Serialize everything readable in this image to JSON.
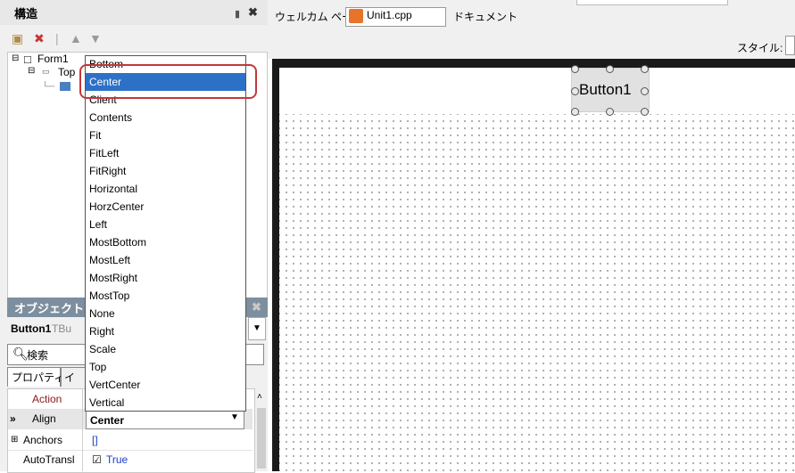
{
  "structure": {
    "title": "構造",
    "tree": {
      "root": "Form1",
      "child": "Top"
    }
  },
  "tabs": {
    "welcome": "ウェルカム ページ",
    "unit1": "Unit1.cpp",
    "docs": "ドキュメント"
  },
  "toolbar": {
    "style_label": "スタイル:"
  },
  "designer": {
    "button_caption": "Button1"
  },
  "inspector": {
    "title": "オブジェクト",
    "object_name": "Button1",
    "object_type": "TBu",
    "search_placeholder": "検索",
    "tab_properties": "プロパティ",
    "tab_events": "イ"
  },
  "properties": [
    {
      "name": "Action",
      "value": ""
    },
    {
      "name": "Align",
      "value": "Center"
    },
    {
      "name": "Anchors",
      "value": "[]"
    },
    {
      "name": "AutoTransl",
      "value": "True"
    }
  ],
  "dropdown": {
    "selected": "Center",
    "options": [
      "Bottom",
      "Center",
      "Client",
      "Contents",
      "Fit",
      "FitLeft",
      "FitRight",
      "Horizontal",
      "HorzCenter",
      "Left",
      "MostBottom",
      "MostLeft",
      "MostRight",
      "MostTop",
      "None",
      "Right",
      "Scale",
      "Top",
      "VertCenter",
      "Vertical"
    ]
  },
  "colors": {
    "selection": "#2d71c7",
    "highlight": "#c0393b",
    "inspector_header": "#7d8f9f"
  }
}
